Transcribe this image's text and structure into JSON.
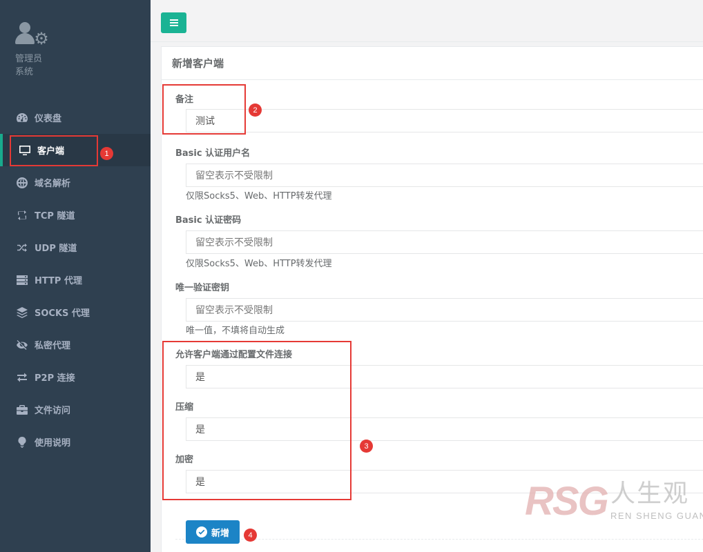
{
  "profile": {
    "name": "管理员",
    "role": "系统"
  },
  "nav": [
    {
      "label": "仪表盘",
      "icon": "dashboard-icon",
      "active": false
    },
    {
      "label": "客户端",
      "icon": "monitor-icon",
      "active": true
    },
    {
      "label": "域名解析",
      "icon": "globe-icon",
      "active": false
    },
    {
      "label": "TCP 隧道",
      "icon": "retweet-icon",
      "active": false
    },
    {
      "label": "UDP 隧道",
      "icon": "random-icon",
      "active": false
    },
    {
      "label": "HTTP 代理",
      "icon": "server-icon",
      "active": false
    },
    {
      "label": "SOCKS 代理",
      "icon": "layers-icon",
      "active": false
    },
    {
      "label": "私密代理",
      "icon": "eye-slash-icon",
      "active": false
    },
    {
      "label": "P2P 连接",
      "icon": "exchange-icon",
      "active": false
    },
    {
      "label": "文件访问",
      "icon": "briefcase-icon",
      "active": false
    },
    {
      "label": "使用说明",
      "icon": "lightbulb-icon",
      "active": false
    }
  ],
  "page": {
    "title": "新增客户端"
  },
  "form": {
    "remark": {
      "label": "备注",
      "value": "测试"
    },
    "basic_user": {
      "label": "Basic 认证用户名",
      "placeholder": "留空表示不受限制",
      "help": "仅限Socks5、Web、HTTP转发代理"
    },
    "basic_pass": {
      "label": "Basic 认证密码",
      "placeholder": "留空表示不受限制",
      "help": "仅限Socks5、Web、HTTP转发代理"
    },
    "vkey": {
      "label": "唯一验证密钥",
      "placeholder": "留空表示不受限制",
      "help": "唯一值，不填将自动生成"
    },
    "config_conn": {
      "label": "允许客户端通过配置文件连接",
      "value": "是"
    },
    "compress": {
      "label": "压缩",
      "value": "是"
    },
    "crypt": {
      "label": "加密",
      "value": "是"
    },
    "submit_label": "新增"
  },
  "annotations": [
    "1",
    "2",
    "3",
    "4"
  ],
  "watermark": {
    "logo": "RSG",
    "cn": "人生观",
    "en": "REN SHENG GUAN"
  },
  "colors": {
    "sidebar": "#2f4050",
    "accent": "#1ab394",
    "primary": "#1c84c6",
    "annotation": "#e53935"
  }
}
